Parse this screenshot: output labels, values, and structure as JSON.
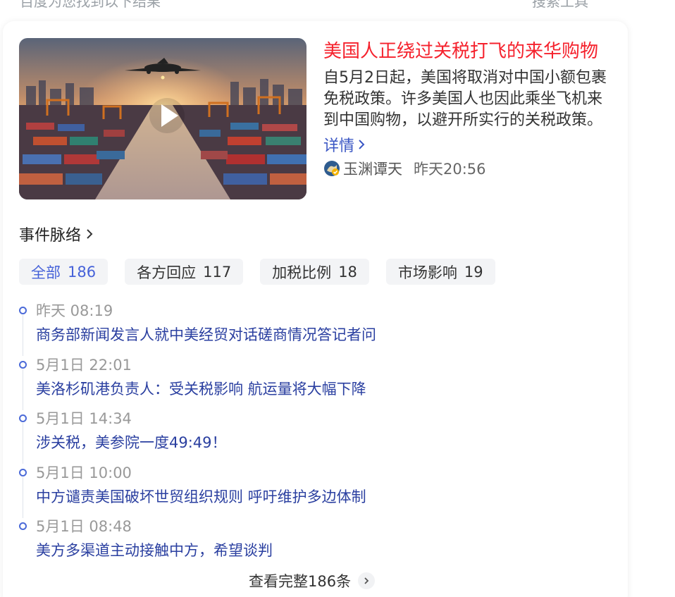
{
  "top_bar": {
    "left_text": "百度为您找到以下结果",
    "right_text": "搜索工具"
  },
  "news": {
    "headline": "美国人正绕过关税打飞的来华购物",
    "summary": "自5月2日起，美国将取消对中国小额包裹免税政策。许多美国人也因此乘坐飞机来到中国购物，以避开所实行的关税政策。",
    "detail_link": "详情",
    "source_name": "玉渊谭天",
    "source_time": "昨天20:56",
    "video_icon": "play-icon"
  },
  "events": {
    "section_title": "事件脉络",
    "tabs": [
      {
        "label": "全部",
        "count": "186",
        "active": true
      },
      {
        "label": "各方回应",
        "count": "117",
        "active": false
      },
      {
        "label": "加税比例",
        "count": "18",
        "active": false
      },
      {
        "label": "市场影响",
        "count": "19",
        "active": false
      }
    ],
    "items": [
      {
        "time": "昨天 08:19",
        "title": "商务部新闻发言人就中美经贸对话磋商情况答记者问"
      },
      {
        "time": "5月1日 22:01",
        "title": "美洛杉矶港负责人：受关税影响 航运量将大幅下降"
      },
      {
        "time": "5月1日 14:34",
        "title": "涉关税，美参院一度49:49！"
      },
      {
        "time": "5月1日 10:00",
        "title": "中方谴责美国破坏世贸组织规则 呼吁维护多边体制"
      },
      {
        "time": "5月1日 08:48",
        "title": "美方多渠道主动接触中方，希望谈判"
      }
    ],
    "more_label": "查看完整186条"
  },
  "colors": {
    "headline": "#f5222d",
    "link": "#2a3fa0",
    "active_tab": "#4662d9",
    "timeline_dot": "#4b6ad8"
  }
}
